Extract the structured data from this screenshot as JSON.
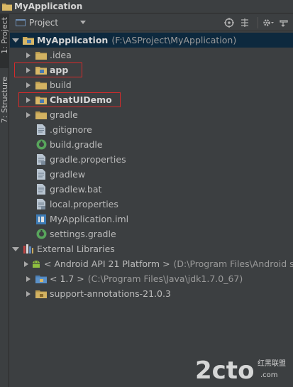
{
  "window": {
    "title": "MyApplication"
  },
  "side_strip": {
    "project_tab": "1: Project",
    "structure_tab": "7: Structure"
  },
  "toolbar": {
    "view_selector": "Project",
    "icons": [
      "target-icon",
      "collapse-icon",
      "gear-icon",
      "hide-icon"
    ]
  },
  "tree": {
    "root": {
      "name": "MyApplication",
      "path": "(F:\\ASProject\\MyApplication)"
    },
    "items": [
      {
        "name": ".idea",
        "type": "folder",
        "expandable": true
      },
      {
        "name": "app",
        "type": "module",
        "expandable": true,
        "bold": true
      },
      {
        "name": "build",
        "type": "folder",
        "expandable": true
      },
      {
        "name": "ChatUIDemo",
        "type": "module",
        "expandable": true,
        "bold": true
      },
      {
        "name": "gradle",
        "type": "folder",
        "expandable": true
      },
      {
        "name": ".gitignore",
        "type": "file"
      },
      {
        "name": "build.gradle",
        "type": "gradle"
      },
      {
        "name": "gradle.properties",
        "type": "properties"
      },
      {
        "name": "gradlew",
        "type": "file"
      },
      {
        "name": "gradlew.bat",
        "type": "file"
      },
      {
        "name": "local.properties",
        "type": "properties"
      },
      {
        "name": "MyApplication.iml",
        "type": "iml"
      },
      {
        "name": "settings.gradle",
        "type": "gradle"
      }
    ],
    "external": {
      "label": "External Libraries",
      "items": [
        {
          "name": "< Android API 21 Platform >",
          "path": "(D:\\Program Files\\Android so"
        },
        {
          "name": "< 1.7 >",
          "path": "(C:\\Program Files\\Java\\jdk1.7.0_67)"
        },
        {
          "name": "support-annotations-21.0.3",
          "path": ""
        }
      ]
    }
  },
  "watermark": {
    "logo": "2cto",
    "suffix": ".com",
    "cn": "红黑联盟"
  },
  "colors": {
    "background": "#3c3f41",
    "selection": "#0d293e",
    "highlight": "#d42b2b",
    "folder": "#c9a85a"
  }
}
